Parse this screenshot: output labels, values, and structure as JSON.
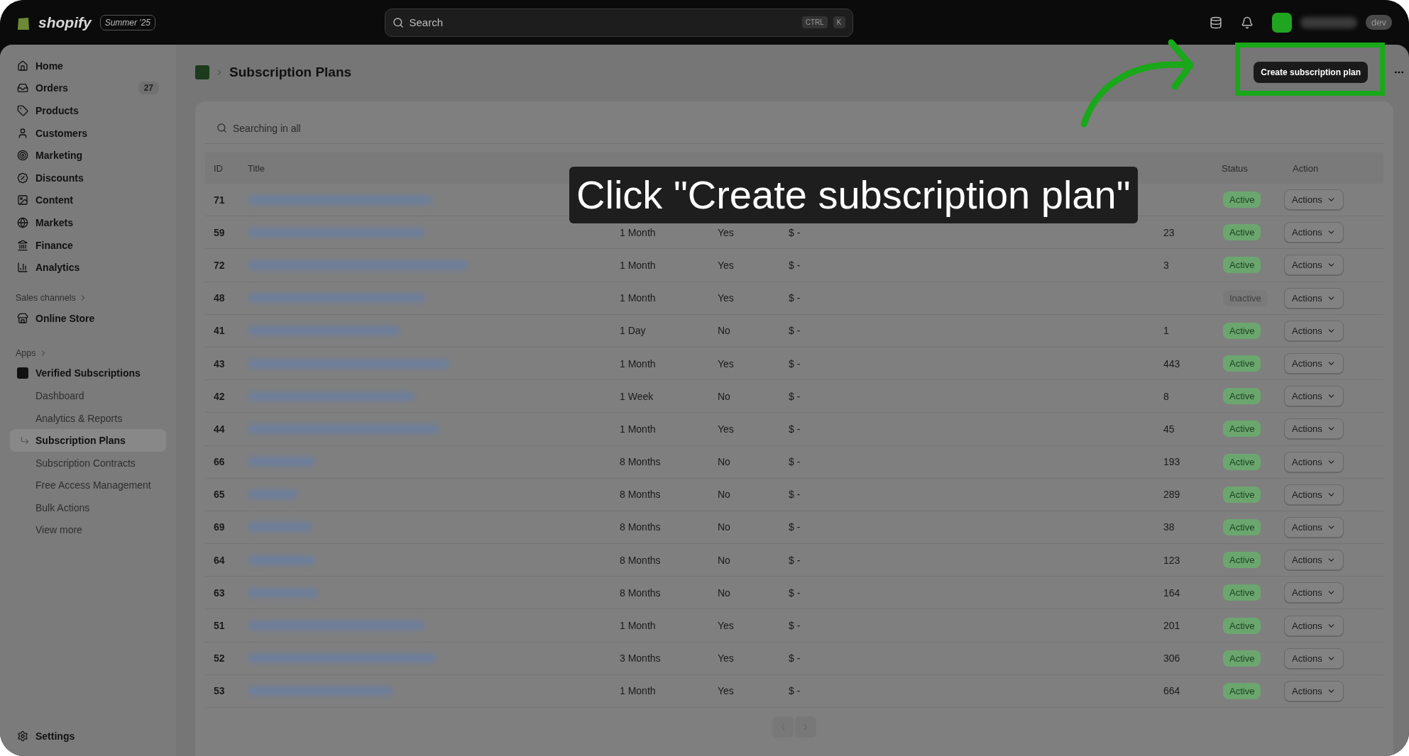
{
  "topbar": {
    "brand": "shopify",
    "edition": "Summer '25",
    "search_placeholder": "Search",
    "shortcut": [
      "CTRL",
      "K"
    ],
    "store_tag": "dev"
  },
  "sidebar": {
    "main": [
      {
        "label": "Home"
      },
      {
        "label": "Orders",
        "count": "27"
      },
      {
        "label": "Products"
      },
      {
        "label": "Customers"
      },
      {
        "label": "Marketing"
      },
      {
        "label": "Discounts"
      },
      {
        "label": "Content"
      },
      {
        "label": "Markets"
      },
      {
        "label": "Finance"
      },
      {
        "label": "Analytics"
      }
    ],
    "sales_channels": {
      "heading": "Sales channels",
      "items": [
        {
          "label": "Online Store"
        }
      ]
    },
    "apps": {
      "heading": "Apps",
      "app": {
        "label": "Verified Subscriptions",
        "children": [
          {
            "label": "Dashboard",
            "selected": false
          },
          {
            "label": "Analytics & Reports",
            "selected": false
          },
          {
            "label": "Subscription Plans",
            "selected": true
          },
          {
            "label": "Subscription Contracts",
            "selected": false
          },
          {
            "label": "Free Access Management",
            "selected": false
          },
          {
            "label": "Bulk Actions",
            "selected": false
          },
          {
            "label": "View more",
            "selected": false
          }
        ]
      }
    },
    "settings": "Settings"
  },
  "page": {
    "title": "Subscription Plans",
    "primary_action": "Create subscription plan"
  },
  "table": {
    "search_placeholder": "Searching in all",
    "columns": {
      "id": "ID",
      "title": "Title",
      "status": "Status",
      "action": "Action"
    },
    "rows": [
      {
        "id": "71",
        "status": "Active",
        "active": true,
        "action": "Actions"
      },
      {
        "id": "59",
        "frequency": "1 Month",
        "recurrent": "Yes",
        "price": "$ -",
        "customers": "23",
        "status": "Active",
        "active": true,
        "action": "Actions"
      },
      {
        "id": "72",
        "frequency": "1 Month",
        "recurrent": "Yes",
        "price": "$ -",
        "customers": "3",
        "status": "Active",
        "active": true,
        "action": "Actions"
      },
      {
        "id": "48",
        "frequency": "1 Month",
        "recurrent": "Yes",
        "price": "$ -",
        "status": "Inactive",
        "active": false,
        "action": "Actions"
      },
      {
        "id": "41",
        "frequency": "1 Day",
        "recurrent": "No",
        "price": "$ -",
        "customers": "1",
        "status": "Active",
        "active": true,
        "action": "Actions"
      },
      {
        "id": "43",
        "frequency": "1 Month",
        "recurrent": "Yes",
        "price": "$ -",
        "customers": "443",
        "status": "Active",
        "active": true,
        "action": "Actions"
      },
      {
        "id": "42",
        "frequency": "1 Week",
        "recurrent": "No",
        "price": "$ -",
        "customers": "8",
        "status": "Active",
        "active": true,
        "action": "Actions"
      },
      {
        "id": "44",
        "frequency": "1 Month",
        "recurrent": "Yes",
        "price": "$ -",
        "customers": "45",
        "status": "Active",
        "active": true,
        "action": "Actions"
      },
      {
        "id": "66",
        "frequency": "8 Months",
        "recurrent": "No",
        "price": "$ -",
        "customers": "193",
        "status": "Active",
        "active": true,
        "action": "Actions"
      },
      {
        "id": "65",
        "frequency": "8 Months",
        "recurrent": "No",
        "price": "$ -",
        "customers": "289",
        "status": "Active",
        "active": true,
        "action": "Actions"
      },
      {
        "id": "69",
        "frequency": "8 Months",
        "recurrent": "No",
        "price": "$ -",
        "customers": "38",
        "status": "Active",
        "active": true,
        "action": "Actions"
      },
      {
        "id": "64",
        "frequency": "8 Months",
        "recurrent": "No",
        "price": "$ -",
        "customers": "123",
        "status": "Active",
        "active": true,
        "action": "Actions"
      },
      {
        "id": "63",
        "frequency": "8 Months",
        "recurrent": "No",
        "price": "$ -",
        "customers": "164",
        "status": "Active",
        "active": true,
        "action": "Actions"
      },
      {
        "id": "51",
        "frequency": "1 Month",
        "recurrent": "Yes",
        "price": "$ -",
        "customers": "201",
        "status": "Active",
        "active": true,
        "action": "Actions"
      },
      {
        "id": "52",
        "frequency": "3 Months",
        "recurrent": "Yes",
        "price": "$ -",
        "customers": "306",
        "status": "Active",
        "active": true,
        "action": "Actions"
      },
      {
        "id": "53",
        "frequency": "1 Month",
        "recurrent": "Yes",
        "price": "$ -",
        "customers": "664",
        "status": "Active",
        "active": true,
        "action": "Actions"
      }
    ]
  },
  "annotation": {
    "caption": "Click \"Create subscription plan\""
  }
}
